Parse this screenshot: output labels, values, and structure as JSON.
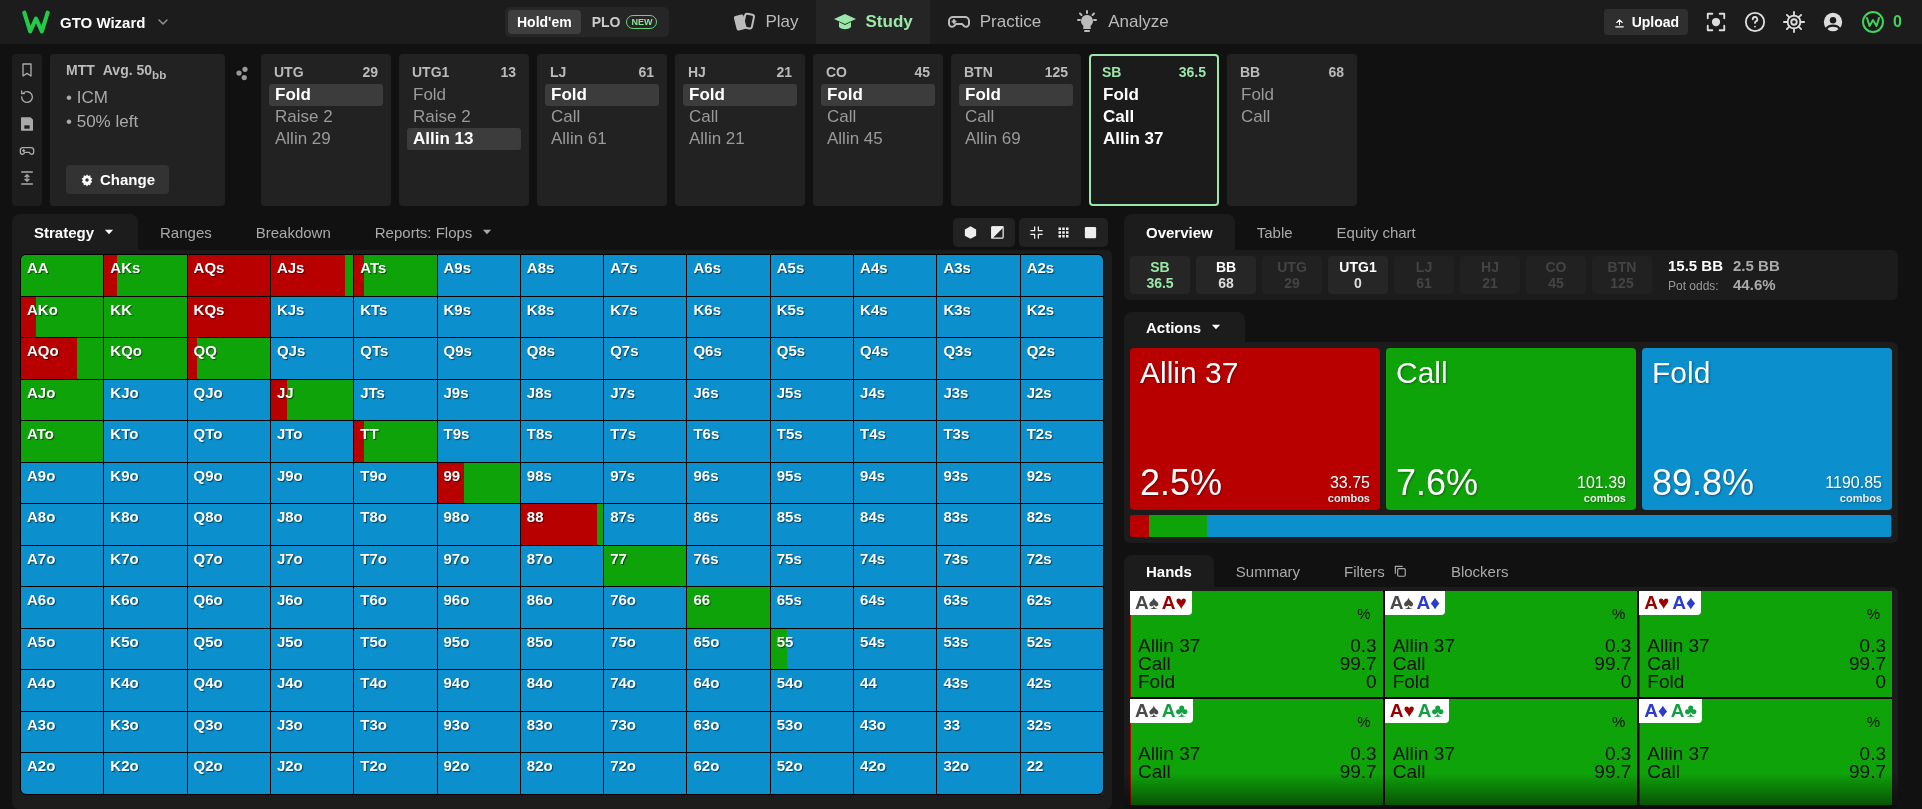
{
  "topbar": {
    "brand": "GTO Wizard",
    "modes": [
      {
        "label": "Hold'em",
        "selected": true
      },
      {
        "label": "PLO",
        "badge": "NEW",
        "selected": false
      }
    ],
    "nav": [
      {
        "label": "Play",
        "kind": "play",
        "selected": false
      },
      {
        "label": "Study",
        "kind": "study",
        "selected": true
      },
      {
        "label": "Practice",
        "kind": "practice",
        "selected": false
      },
      {
        "label": "Analyze",
        "kind": "analyze",
        "selected": false
      }
    ],
    "upload": "Upload",
    "coins": "0"
  },
  "header": {
    "format": "MTT",
    "stack": "Avg. 50$_{bb}$",
    "notes": [
      "• ICM",
      "• 50% left"
    ],
    "change_button": "Change",
    "positions": [
      {
        "name": "UTG",
        "stack": "29",
        "current": false,
        "actions": [
          {
            "label": "Fold",
            "selected": true
          },
          {
            "label": "Raise 2",
            "selected": false
          },
          {
            "label": "Allin 29",
            "selected": false
          }
        ]
      },
      {
        "name": "UTG1",
        "stack": "13",
        "current": false,
        "actions": [
          {
            "label": "Fold",
            "selected": false
          },
          {
            "label": "Raise 2",
            "selected": false
          },
          {
            "label": "Allin 13",
            "selected": true
          }
        ]
      },
      {
        "name": "LJ",
        "stack": "61",
        "current": false,
        "actions": [
          {
            "label": "Fold",
            "selected": true
          },
          {
            "label": "Call",
            "selected": false
          },
          {
            "label": "Allin 61",
            "selected": false
          }
        ]
      },
      {
        "name": "HJ",
        "stack": "21",
        "current": false,
        "actions": [
          {
            "label": "Fold",
            "selected": true
          },
          {
            "label": "Call",
            "selected": false
          },
          {
            "label": "Allin 21",
            "selected": false
          }
        ]
      },
      {
        "name": "CO",
        "stack": "45",
        "current": false,
        "actions": [
          {
            "label": "Fold",
            "selected": true
          },
          {
            "label": "Call",
            "selected": false
          },
          {
            "label": "Allin 45",
            "selected": false
          }
        ]
      },
      {
        "name": "BTN",
        "stack": "125",
        "current": false,
        "actions": [
          {
            "label": "Fold",
            "selected": true
          },
          {
            "label": "Call",
            "selected": false
          },
          {
            "label": "Allin 69",
            "selected": false
          }
        ]
      },
      {
        "name": "SB",
        "stack": "36.5",
        "current": true,
        "actions": [
          {
            "label": "Fold",
            "selected": false
          },
          {
            "label": "Call",
            "selected": false
          },
          {
            "label": "Allin 37",
            "selected": false
          }
        ]
      },
      {
        "name": "BB",
        "stack": "68",
        "current": false,
        "actions": [
          {
            "label": "Fold",
            "selected": false
          },
          {
            "label": "Call",
            "selected": false
          }
        ]
      }
    ]
  },
  "strategy": {
    "tabs": [
      {
        "label": "Strategy",
        "dropdown": true,
        "selected": true
      },
      {
        "label": "Ranges",
        "dropdown": false,
        "selected": false
      },
      {
        "label": "Breakdown",
        "dropdown": false,
        "selected": false
      },
      {
        "label": "Reports: Flops",
        "dropdown": true,
        "selected": false
      }
    ],
    "grid": [
      [
        {
          "hand": "AA",
          "mix": [
            {
              "kind": "call",
              "level": 1
            }
          ]
        },
        {
          "hand": "AKs",
          "mix": [
            {
              "kind": "allin",
              "level": 0.15
            },
            {
              "kind": "call",
              "level": 0.85
            }
          ]
        },
        {
          "hand": "AQs",
          "mix": [
            {
              "kind": "allin",
              "level": 1
            }
          ]
        },
        {
          "hand": "AJs",
          "mix": [
            {
              "kind": "allin",
              "level": 0.9
            },
            {
              "kind": "call",
              "level": 0.1
            }
          ]
        },
        {
          "hand": "ATs",
          "mix": [
            {
              "kind": "allin",
              "level": 0.12
            },
            {
              "kind": "call",
              "level": 0.88
            }
          ]
        },
        {
          "hand": "A9s"
        },
        {
          "hand": "A8s"
        },
        {
          "hand": "A7s"
        },
        {
          "hand": "A6s"
        },
        {
          "hand": "A5s"
        },
        {
          "hand": "A4s"
        },
        {
          "hand": "A3s"
        },
        {
          "hand": "A2s"
        }
      ],
      [
        {
          "hand": "AKo",
          "mix": [
            {
              "kind": "allin",
              "level": 0.18
            },
            {
              "kind": "call",
              "level": 0.82
            }
          ]
        },
        {
          "hand": "KK",
          "mix": [
            {
              "kind": "call",
              "level": 1
            }
          ]
        },
        {
          "hand": "KQs",
          "mix": [
            {
              "kind": "allin",
              "level": 1
            }
          ]
        },
        {
          "hand": "KJs"
        },
        {
          "hand": "KTs"
        },
        {
          "hand": "K9s"
        },
        {
          "hand": "K8s"
        },
        {
          "hand": "K7s"
        },
        {
          "hand": "K6s"
        },
        {
          "hand": "K5s"
        },
        {
          "hand": "K4s"
        },
        {
          "hand": "K3s"
        },
        {
          "hand": "K2s"
        }
      ],
      [
        {
          "hand": "AQo",
          "mix": [
            {
              "kind": "allin",
              "level": 0.68
            },
            {
              "kind": "call",
              "level": 0.32
            }
          ]
        },
        {
          "hand": "KQo",
          "mix": [
            {
              "kind": "call",
              "level": 1
            }
          ]
        },
        {
          "hand": "QQ",
          "mix": [
            {
              "kind": "allin",
              "level": 0.12
            },
            {
              "kind": "call",
              "level": 0.88
            }
          ]
        },
        {
          "hand": "QJs"
        },
        {
          "hand": "QTs"
        },
        {
          "hand": "Q9s"
        },
        {
          "hand": "Q8s"
        },
        {
          "hand": "Q7s"
        },
        {
          "hand": "Q6s"
        },
        {
          "hand": "Q5s"
        },
        {
          "hand": "Q4s"
        },
        {
          "hand": "Q3s"
        },
        {
          "hand": "Q2s"
        }
      ],
      [
        {
          "hand": "AJo",
          "mix": [
            {
              "kind": "call",
              "level": 1
            }
          ]
        },
        {
          "hand": "KJo"
        },
        {
          "hand": "QJo"
        },
        {
          "hand": "JJ",
          "mix": [
            {
              "kind": "allin",
              "level": 0.2
            },
            {
              "kind": "call",
              "level": 0.8
            }
          ]
        },
        {
          "hand": "JTs"
        },
        {
          "hand": "J9s"
        },
        {
          "hand": "J8s"
        },
        {
          "hand": "J7s"
        },
        {
          "hand": "J6s"
        },
        {
          "hand": "J5s"
        },
        {
          "hand": "J4s"
        },
        {
          "hand": "J3s"
        },
        {
          "hand": "J2s"
        }
      ],
      [
        {
          "hand": "ATo",
          "mix": [
            {
              "kind": "call",
              "level": 1
            }
          ]
        },
        {
          "hand": "KTo"
        },
        {
          "hand": "QTo"
        },
        {
          "hand": "JTo"
        },
        {
          "hand": "TT",
          "mix": [
            {
              "kind": "allin",
              "level": 0.12
            },
            {
              "kind": "call",
              "level": 0.88
            }
          ]
        },
        {
          "hand": "T9s"
        },
        {
          "hand": "T8s"
        },
        {
          "hand": "T7s"
        },
        {
          "hand": "T6s"
        },
        {
          "hand": "T5s"
        },
        {
          "hand": "T4s"
        },
        {
          "hand": "T3s"
        },
        {
          "hand": "T2s"
        }
      ],
      [
        {
          "hand": "A9o"
        },
        {
          "hand": "K9o"
        },
        {
          "hand": "Q9o"
        },
        {
          "hand": "J9o"
        },
        {
          "hand": "T9o"
        },
        {
          "hand": "99",
          "mix": [
            {
              "kind": "allin",
              "level": 0.32
            },
            {
              "kind": "call",
              "level": 0.68
            }
          ]
        },
        {
          "hand": "98s"
        },
        {
          "hand": "97s"
        },
        {
          "hand": "96s"
        },
        {
          "hand": "95s"
        },
        {
          "hand": "94s"
        },
        {
          "hand": "93s"
        },
        {
          "hand": "92s"
        }
      ],
      [
        {
          "hand": "A8o"
        },
        {
          "hand": "K8o"
        },
        {
          "hand": "Q8o"
        },
        {
          "hand": "J8o"
        },
        {
          "hand": "T8o"
        },
        {
          "hand": "98o"
        },
        {
          "hand": "88",
          "mix": [
            {
              "kind": "allin",
              "level": 0.93
            },
            {
              "kind": "call",
              "level": 0.07
            }
          ]
        },
        {
          "hand": "87s"
        },
        {
          "hand": "86s"
        },
        {
          "hand": "85s"
        },
        {
          "hand": "84s"
        },
        {
          "hand": "83s"
        },
        {
          "hand": "82s"
        }
      ],
      [
        {
          "hand": "A7o"
        },
        {
          "hand": "K7o"
        },
        {
          "hand": "Q7o"
        },
        {
          "hand": "J7o"
        },
        {
          "hand": "T7o"
        },
        {
          "hand": "97o"
        },
        {
          "hand": "87o"
        },
        {
          "hand": "77",
          "mix": [
            {
              "kind": "call",
              "level": 1
            }
          ]
        },
        {
          "hand": "76s"
        },
        {
          "hand": "75s"
        },
        {
          "hand": "74s"
        },
        {
          "hand": "73s"
        },
        {
          "hand": "72s"
        }
      ],
      [
        {
          "hand": "A6o"
        },
        {
          "hand": "K6o"
        },
        {
          "hand": "Q6o"
        },
        {
          "hand": "J6o"
        },
        {
          "hand": "T6o"
        },
        {
          "hand": "96o"
        },
        {
          "hand": "86o"
        },
        {
          "hand": "76o"
        },
        {
          "hand": "66",
          "mix": [
            {
              "kind": "call",
              "level": 1
            }
          ]
        },
        {
          "hand": "65s"
        },
        {
          "hand": "64s"
        },
        {
          "hand": "63s"
        },
        {
          "hand": "62s"
        }
      ],
      [
        {
          "hand": "A5o"
        },
        {
          "hand": "K5o"
        },
        {
          "hand": "Q5o"
        },
        {
          "hand": "J5o"
        },
        {
          "hand": "T5o"
        },
        {
          "hand": "95o"
        },
        {
          "hand": "85o"
        },
        {
          "hand": "75o"
        },
        {
          "hand": "65o"
        },
        {
          "hand": "55",
          "mix": [
            {
              "kind": "call",
              "level": 0.2
            }
          ]
        },
        {
          "hand": "54s"
        },
        {
          "hand": "53s"
        },
        {
          "hand": "52s"
        }
      ],
      [
        {
          "hand": "A4o"
        },
        {
          "hand": "K4o"
        },
        {
          "hand": "Q4o"
        },
        {
          "hand": "J4o"
        },
        {
          "hand": "T4o"
        },
        {
          "hand": "94o"
        },
        {
          "hand": "84o"
        },
        {
          "hand": "74o"
        },
        {
          "hand": "64o"
        },
        {
          "hand": "54o"
        },
        {
          "hand": "44"
        },
        {
          "hand": "43s"
        },
        {
          "hand": "42s"
        }
      ],
      [
        {
          "hand": "A3o"
        },
        {
          "hand": "K3o"
        },
        {
          "hand": "Q3o"
        },
        {
          "hand": "J3o"
        },
        {
          "hand": "T3o"
        },
        {
          "hand": "93o"
        },
        {
          "hand": "83o"
        },
        {
          "hand": "73o"
        },
        {
          "hand": "63o"
        },
        {
          "hand": "53o"
        },
        {
          "hand": "43o"
        },
        {
          "hand": "33"
        },
        {
          "hand": "32s"
        }
      ],
      [
        {
          "hand": "A2o"
        },
        {
          "hand": "K2o"
        },
        {
          "hand": "Q2o"
        },
        {
          "hand": "J2o"
        },
        {
          "hand": "T2o"
        },
        {
          "hand": "92o"
        },
        {
          "hand": "82o"
        },
        {
          "hand": "72o"
        },
        {
          "hand": "62o"
        },
        {
          "hand": "52o"
        },
        {
          "hand": "42o"
        },
        {
          "hand": "32o"
        },
        {
          "hand": "22"
        }
      ]
    ]
  },
  "overview": {
    "tabs": [
      {
        "label": "Overview",
        "selected": true
      },
      {
        "label": "Table",
        "selected": false
      },
      {
        "label": "Equity chart",
        "selected": false
      }
    ],
    "players": [
      {
        "name": "SB",
        "stack": "36.5",
        "current": true,
        "folded": false
      },
      {
        "name": "BB",
        "stack": "68",
        "current": false,
        "folded": false
      },
      {
        "name": "UTG",
        "stack": "29",
        "current": false,
        "folded": true
      },
      {
        "name": "UTG1",
        "stack": "0",
        "current": false,
        "folded": false
      },
      {
        "name": "LJ",
        "stack": "61",
        "current": false,
        "folded": true
      },
      {
        "name": "HJ",
        "stack": "21",
        "current": false,
        "folded": true
      },
      {
        "name": "CO",
        "stack": "45",
        "current": false,
        "folded": true
      },
      {
        "name": "BTN",
        "stack": "125",
        "current": false,
        "folded": true
      }
    ],
    "pot": "15.5 BB",
    "to_call": "2.5 BB",
    "pot_odds_label": "Pot odds:",
    "pot_odds": "44.6%"
  },
  "actions": {
    "tab": "Actions",
    "dropdown": true,
    "items": [
      {
        "kind": "allin",
        "label": "Allin 37",
        "percent": "2.5%",
        "combos": "33.75",
        "combos_label": "combos"
      },
      {
        "kind": "call",
        "label": "Call",
        "percent": "7.6%",
        "combos": "101.39",
        "combos_label": "combos"
      },
      {
        "kind": "fold",
        "label": "Fold",
        "percent": "89.8%",
        "combos": "1190.85",
        "combos_label": "combos"
      }
    ],
    "bar": [
      {
        "kind": "allin",
        "level": 0.025
      },
      {
        "kind": "call",
        "level": 0.076
      },
      {
        "kind": "fold",
        "level": 0.898
      }
    ]
  },
  "hands": {
    "tabs": [
      {
        "label": "Hands",
        "selected": true,
        "has_icon": false
      },
      {
        "label": "Summary",
        "selected": false,
        "has_icon": false
      },
      {
        "label": "Filters",
        "selected": false,
        "has_icon": true
      },
      {
        "label": "Blockers",
        "selected": false,
        "has_icon": false
      }
    ],
    "cards": [
      {
        "cards": [
          {
            "rank": "A",
            "suit": "♠",
            "color": "#4a4a4a"
          },
          {
            "rank": "A",
            "suit": "♥",
            "color": "#9b0000"
          }
        ],
        "unit": "%",
        "mix": [
          {
            "kind": "allin",
            "level": 0.003
          },
          {
            "kind": "call",
            "level": 0.997
          }
        ],
        "rows": [
          {
            "action": "Allin 37",
            "value": "0.3"
          },
          {
            "action": "Call",
            "value": "99.7"
          },
          {
            "action": "Fold",
            "value": "0"
          }
        ]
      },
      {
        "cards": [
          {
            "rank": "A",
            "suit": "♠",
            "color": "#4a4a4a"
          },
          {
            "rank": "A",
            "suit": "♦",
            "color": "#2a3ccf"
          }
        ],
        "unit": "%",
        "mix": [
          {
            "kind": "allin",
            "level": 0.003
          },
          {
            "kind": "call",
            "level": 0.997
          }
        ],
        "rows": [
          {
            "action": "Allin 37",
            "value": "0.3"
          },
          {
            "action": "Call",
            "value": "99.7"
          },
          {
            "action": "Fold",
            "value": "0"
          }
        ]
      },
      {
        "cards": [
          {
            "rank": "A",
            "suit": "♥",
            "color": "#9b0000"
          },
          {
            "rank": "A",
            "suit": "♦",
            "color": "#2a3ccf"
          }
        ],
        "unit": "%",
        "mix": [
          {
            "kind": "allin",
            "level": 0.003
          },
          {
            "kind": "call",
            "level": 0.997
          }
        ],
        "rows": [
          {
            "action": "Allin 37",
            "value": "0.3"
          },
          {
            "action": "Call",
            "value": "99.7"
          },
          {
            "action": "Fold",
            "value": "0"
          }
        ]
      },
      {
        "cards": [
          {
            "rank": "A",
            "suit": "♠",
            "color": "#4a4a4a"
          },
          {
            "rank": "A",
            "suit": "♣",
            "color": "#13a040"
          }
        ],
        "unit": "%",
        "mix": [
          {
            "kind": "allin",
            "level": 0.003
          },
          {
            "kind": "call",
            "level": 0.997
          }
        ],
        "rows": [
          {
            "action": "Allin 37",
            "value": "0.3"
          },
          {
            "action": "Call",
            "value": "99.7"
          }
        ]
      },
      {
        "cards": [
          {
            "rank": "A",
            "suit": "♥",
            "color": "#9b0000"
          },
          {
            "rank": "A",
            "suit": "♣",
            "color": "#13a040"
          }
        ],
        "unit": "%",
        "mix": [
          {
            "kind": "allin",
            "level": 0.003
          },
          {
            "kind": "call",
            "level": 0.997
          }
        ],
        "rows": [
          {
            "action": "Allin 37",
            "value": "0.3"
          },
          {
            "action": "Call",
            "value": "99.7"
          }
        ]
      },
      {
        "cards": [
          {
            "rank": "A",
            "suit": "♦",
            "color": "#2a3ccf"
          },
          {
            "rank": "A",
            "suit": "♣",
            "color": "#13a040"
          }
        ],
        "unit": "%",
        "mix": [
          {
            "kind": "allin",
            "level": 0.003
          },
          {
            "kind": "call",
            "level": 0.997
          }
        ],
        "rows": [
          {
            "action": "Allin 37",
            "value": "0.3"
          },
          {
            "action": "Call",
            "value": "99.7"
          }
        ]
      }
    ]
  }
}
